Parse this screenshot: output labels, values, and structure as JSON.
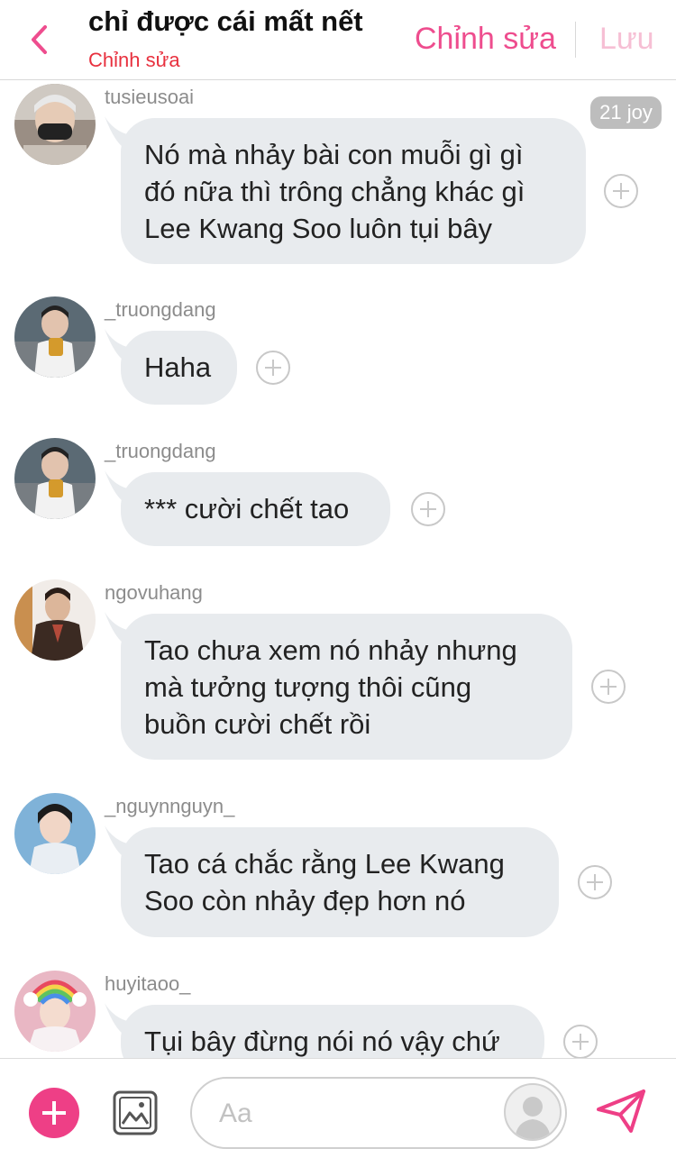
{
  "header": {
    "title": "chỉ được cái mất nết",
    "subtitle": "Chỉnh sửa",
    "edit_label": "Chỉnh sửa",
    "save_label": "Lưu",
    "accent_color": "#ee4d8e"
  },
  "messages": [
    {
      "username": "tusieusoai",
      "text": "Nó mà nhảy bài con muỗi gì gì\nđó nữa thì trông chẳng khác gì\nLee Kwang Soo luôn tụi bây",
      "badge": "21 joy"
    },
    {
      "username": "_truongdang",
      "text": "Haha"
    },
    {
      "username": "_truongdang",
      "text": "*** cười chết tao"
    },
    {
      "username": "ngovuhang",
      "text": "Tao chưa xem nó nhảy nhưng\nmà tưởng tượng thôi cũng\nbuồn cười chết rồi"
    },
    {
      "username": "_nguynnguyn_",
      "text": "Tao cá chắc rằng Lee Kwang\nSoo còn nhảy đẹp hơn nó"
    },
    {
      "username": "huyitaoo_",
      "text": "Tụi bây đừng nói nó vậy chứ"
    }
  ],
  "composer": {
    "placeholder": "Aa",
    "value": ""
  }
}
